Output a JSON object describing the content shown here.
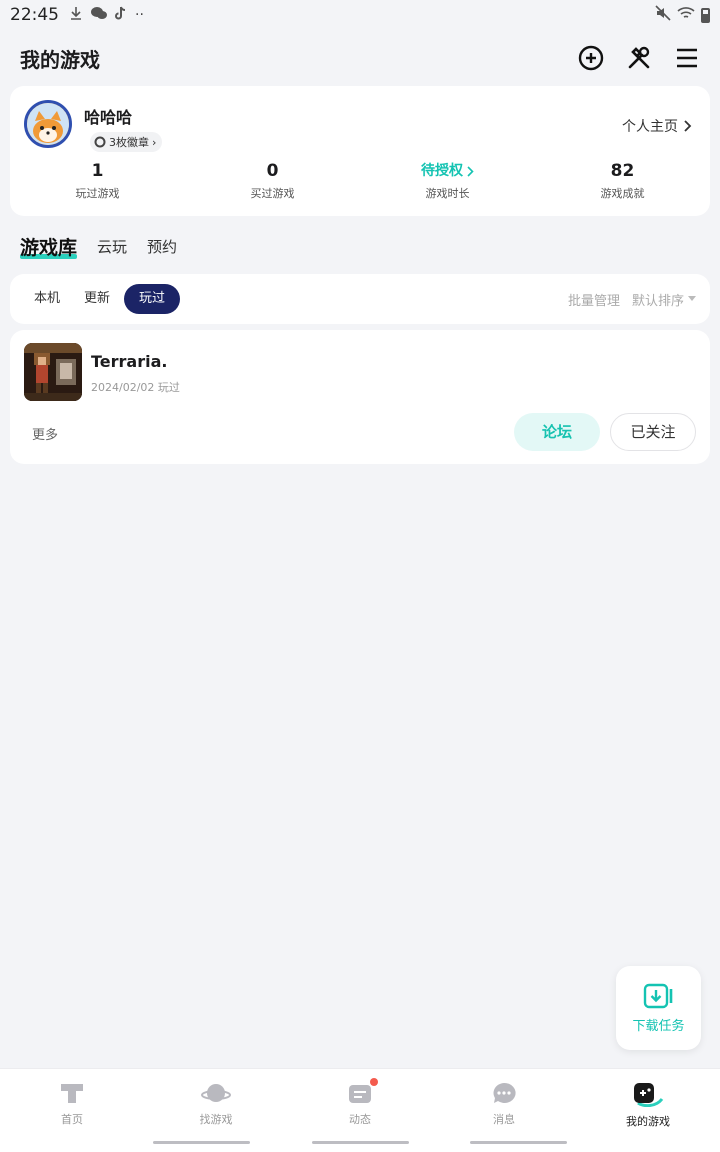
{
  "status_bar": {
    "time": "22:45",
    "notification_icons": [
      "download-icon",
      "wechat-icon",
      "tiktok-icon",
      "more-dots-icon"
    ],
    "system_icons": [
      "mute-icon",
      "wifi-icon",
      "battery-icon"
    ]
  },
  "header": {
    "title": "我的游戏",
    "actions": [
      "add-circle-icon",
      "tools-icon",
      "menu-icon"
    ]
  },
  "profile": {
    "username": "哈哈哈",
    "badge": "3枚徽章",
    "homepage_link": "个人主页",
    "stats": [
      {
        "value": "1",
        "label": "玩过游戏"
      },
      {
        "value": "0",
        "label": "买过游戏"
      },
      {
        "value": "待授权",
        "label": "游戏时长"
      },
      {
        "value": "82",
        "label": "游戏成就"
      }
    ]
  },
  "library_tabs": [
    {
      "label": "游戏库",
      "active": true
    },
    {
      "label": "云玩",
      "active": false
    },
    {
      "label": "预约",
      "active": false
    }
  ],
  "filters": {
    "chips": [
      {
        "label": "本机",
        "active": false
      },
      {
        "label": "更新",
        "active": false
      },
      {
        "label": "玩过",
        "active": true
      }
    ],
    "batch_manage": "批量管理",
    "sort": "默认排序"
  },
  "games": [
    {
      "name": "Terraria.",
      "played": "2024/02/02 玩过",
      "more": "更多",
      "forum_button": "论坛",
      "follow_button": "已关注"
    }
  ],
  "download_task": "下载任务",
  "bottom_nav": [
    {
      "label": "首页",
      "icon": "home-icon",
      "active": false
    },
    {
      "label": "找游戏",
      "icon": "planet-icon",
      "active": false
    },
    {
      "label": "动态",
      "icon": "feed-icon",
      "active": false,
      "dot": true
    },
    {
      "label": "消息",
      "icon": "message-icon",
      "active": false
    },
    {
      "label": "我的游戏",
      "icon": "gamepad-icon",
      "active": true
    }
  ],
  "colors": {
    "accent": "#14c3b2",
    "active_chip": "#1b2466",
    "background": "#f3f4f7",
    "notification_dot": "#f45b4e"
  }
}
